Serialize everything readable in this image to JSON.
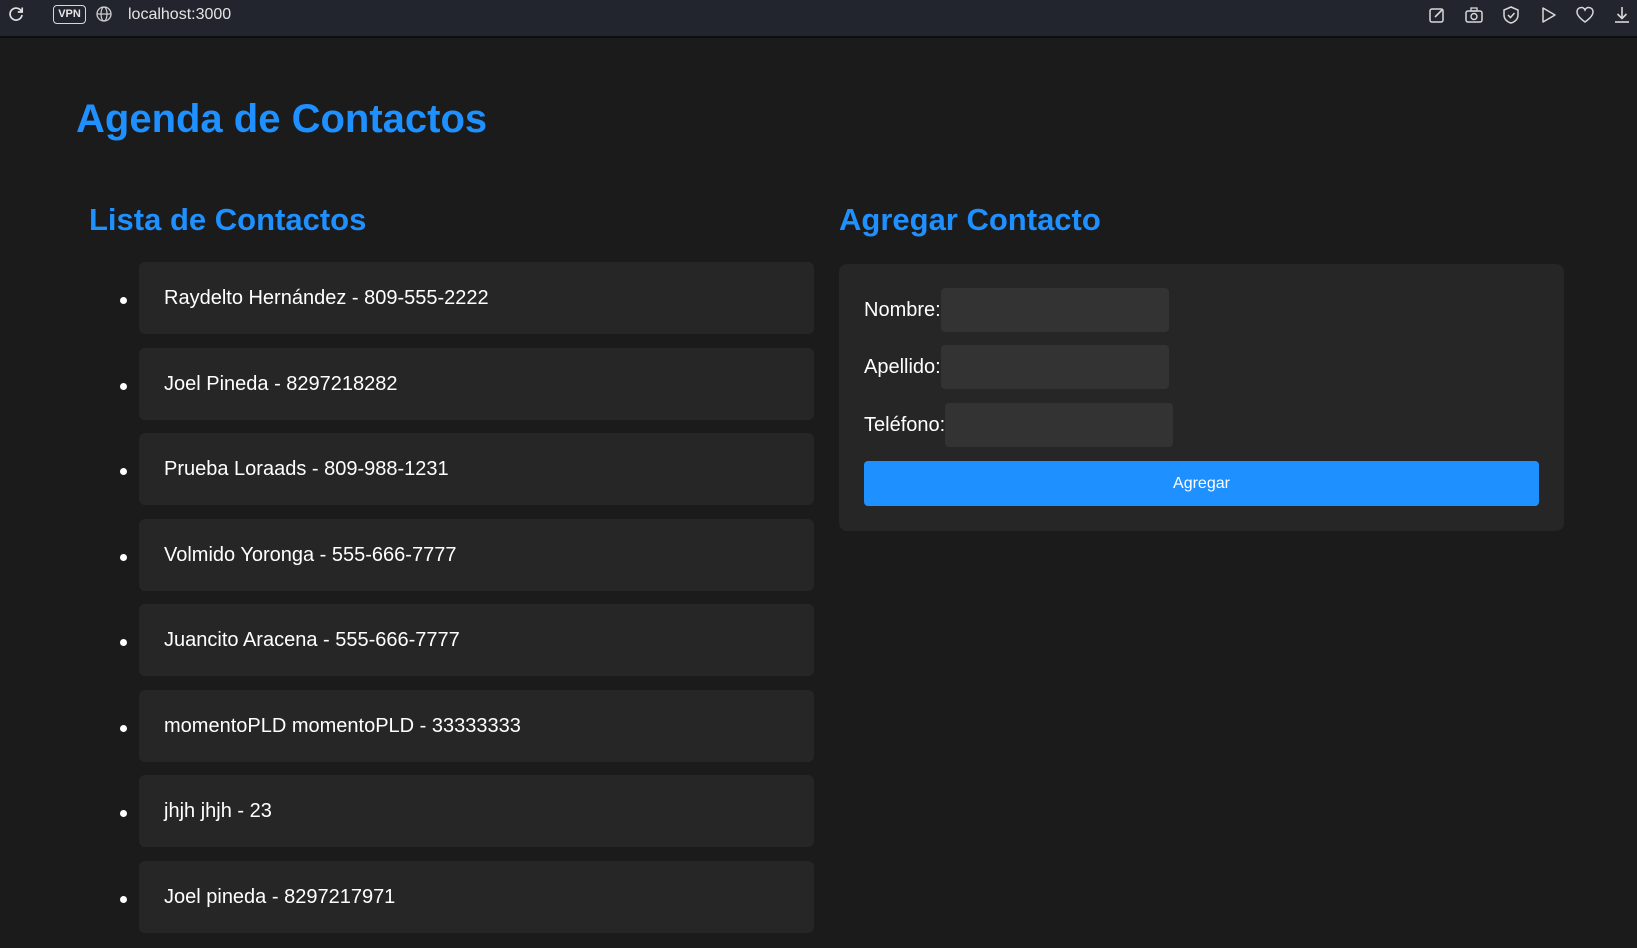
{
  "browser": {
    "vpn_label": "VPN",
    "url": "localhost:3000",
    "icons": [
      "reload-icon",
      "globe-icon",
      "edit-icon",
      "camera-icon",
      "shield-icon",
      "play-icon",
      "heart-icon",
      "download-icon"
    ]
  },
  "page": {
    "title": "Agenda de Contactos"
  },
  "list": {
    "title": "Lista de Contactos",
    "contacts": [
      "Raydelto Hernández - 809-555-2222",
      "Joel Pineda - 8297218282",
      "Prueba Loraads - 809-988-1231",
      "Volmido Yoronga - 555-666-7777",
      "Juancito Aracena - 555-666-7777",
      "momentoPLD momentoPLD - 33333333",
      "jhjh jhjh - 23",
      "Joel pineda - 8297217971"
    ]
  },
  "form": {
    "title": "Agregar Contacto",
    "nombre_label": "Nombre:",
    "nombre_value": "",
    "apellido_label": "Apellido:",
    "apellido_value": "",
    "telefono_label": "Teléfono:",
    "telefono_value": "",
    "submit_label": "Agregar"
  },
  "colors": {
    "accent": "#1e90ff",
    "background": "#1b1b1b",
    "card": "#262626",
    "input": "#333333",
    "toolbar": "#23252e"
  }
}
